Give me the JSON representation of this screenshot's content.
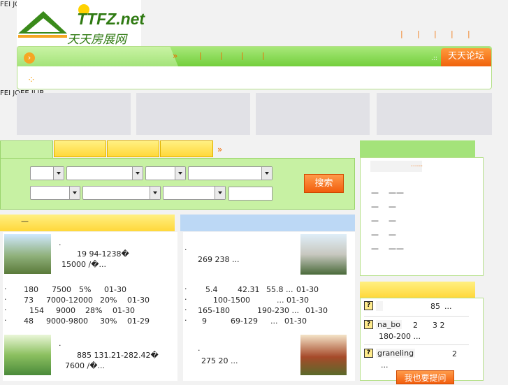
{
  "header": {
    "alt_text": "FEI JOEE ILJB",
    "logo_brand": "TTFZ.net",
    "logo_tagline": "天天房展网",
    "top_links": [
      "|",
      "|",
      "|",
      "|",
      "|"
    ]
  },
  "nav": {
    "arrows": "»",
    "separators": [
      "|",
      "|",
      "|",
      "|"
    ],
    "forum_label": "天天论坛",
    "dots": ".::"
  },
  "banners_alt": "FEI JOEE ILJB",
  "search": {
    "tab_arrow": "»",
    "button_label": "搜索",
    "text_input_value": ""
  },
  "listing_left": {
    "head_dash": "—",
    "card1": {
      "dot": ".",
      "line1": "19      94-1238�",
      "line2": "15000 /�..."
    },
    "rows": [
      {
        "dot": ".",
        "a": "180",
        "b": "7500",
        "c": "5%",
        "d": "01-30"
      },
      {
        "dot": ".",
        "a": "73",
        "b": "7000-12000",
        "c": "20%",
        "d": "01-30"
      },
      {
        "dot": ".",
        "a": "154",
        "b": "9000",
        "c": "28%",
        "d": "01-30"
      },
      {
        "dot": ".",
        "a": "48",
        "b": "9000-9800",
        "c": "30%",
        "d": "01-29"
      }
    ],
    "card2": {
      "dot": ".",
      "line1": "885       131.21-282.42�",
      "line2": "7600 /�..."
    }
  },
  "listing_right": {
    "card1": {
      "dot": ".",
      "line1": "269       238          ..."
    },
    "rows": [
      {
        "dot": ".",
        "a": "5.4",
        "b": "42.31",
        "c": "55.8 ...",
        "d": "01-30"
      },
      {
        "dot": ".",
        "a": "100-1500",
        "b": "",
        "c": "... 01-30",
        "d": ""
      },
      {
        "dot": ".",
        "a": "165-180",
        "b": "190-230 ...",
        "c": "",
        "d": "01-30"
      },
      {
        "dot": ".",
        "a": "9",
        "b": "69-129",
        "c": "...",
        "d": "01-30"
      }
    ],
    "card2": {
      "dot": ".",
      "line1": "275          20           ..."
    }
  },
  "sidebar": {
    "more": "......",
    "items": [
      {
        "a": "—",
        "b": "——"
      },
      {
        "a": "—",
        "b": "—"
      },
      {
        "a": "—",
        "b": "—"
      },
      {
        "a": "—",
        "b": "—"
      },
      {
        "a": "—",
        "b": "——"
      }
    ]
  },
  "qa": {
    "items": [
      {
        "user": "",
        "num": "85",
        "tail": "..."
      },
      {
        "user": "na_bo",
        "num": "2",
        "num2": "3 2",
        "line2": "180-200 ..."
      },
      {
        "user": "graneling",
        "num": "2",
        "line2": "..."
      }
    ],
    "ask_button": "我也要提问"
  },
  "colors": {
    "green": "#a4e37a",
    "orange": "#f25e0e",
    "yellow": "#ffd83a",
    "blue": "#bcd8f5"
  }
}
